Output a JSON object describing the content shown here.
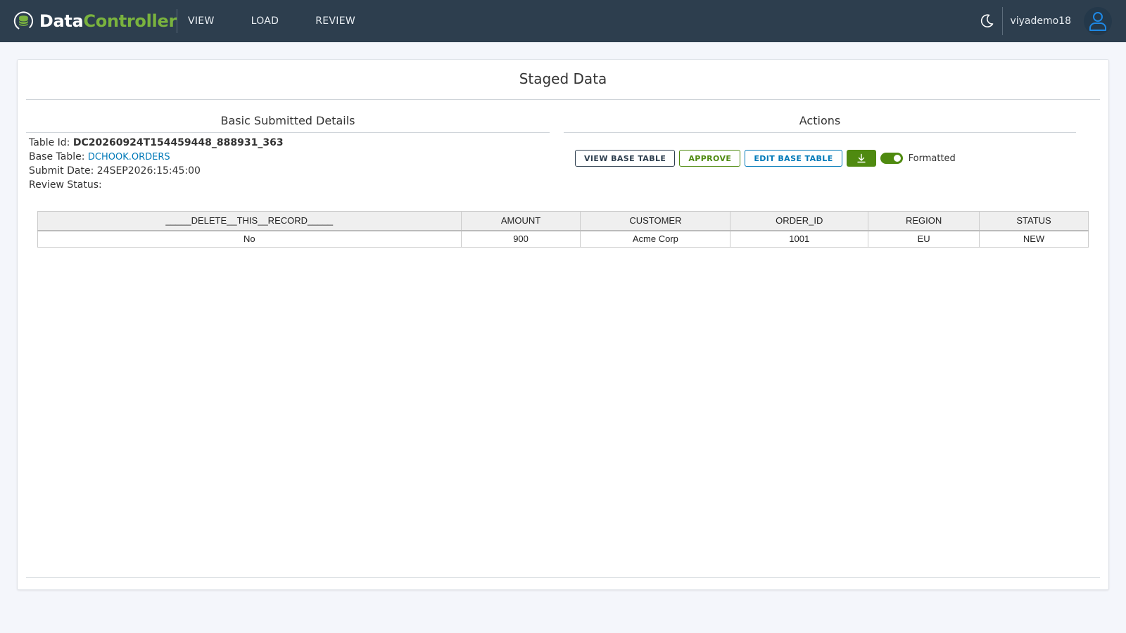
{
  "header": {
    "brand_part1": "Data",
    "brand_part2": "Controller",
    "nav": [
      {
        "label": "VIEW"
      },
      {
        "label": "LOAD"
      },
      {
        "label": "REVIEW"
      }
    ],
    "username": "viyademo18",
    "icons": {
      "theme": "moon-icon",
      "user": "user-icon",
      "logo": "database-icon"
    }
  },
  "page": {
    "title": "Staged Data"
  },
  "details": {
    "section_title": "Basic Submitted Details",
    "table_id_label": "Table Id:",
    "table_id_value": "DC20260924T154459448_888931_363",
    "base_table_label": "Base Table:",
    "base_table_value": "DCHOOK.ORDERS",
    "submit_date_label": "Submit Date:",
    "submit_date_value": "24SEP2026:15:45:00",
    "review_status_label": "Review Status:",
    "review_status_value": ""
  },
  "actions": {
    "section_title": "Actions",
    "view_base_table": "VIEW BASE TABLE",
    "approve": "APPROVE",
    "edit_base_table": "EDIT BASE TABLE",
    "download_icon": "download-icon",
    "formatted_label": "Formatted",
    "formatted_on": true
  },
  "table": {
    "columns": [
      "_____DELETE__THIS__RECORD_____",
      "AMOUNT",
      "CUSTOMER",
      "ORDER_ID",
      "REGION",
      "STATUS"
    ],
    "rows": [
      [
        "No",
        "900",
        "Acme Corp",
        "1001",
        "EU",
        "NEW"
      ]
    ]
  },
  "colors": {
    "header_bg": "#2d3e4e",
    "brand_green": "#7ab33e",
    "action_green": "#4f8a10",
    "link_blue": "#0079b8"
  }
}
